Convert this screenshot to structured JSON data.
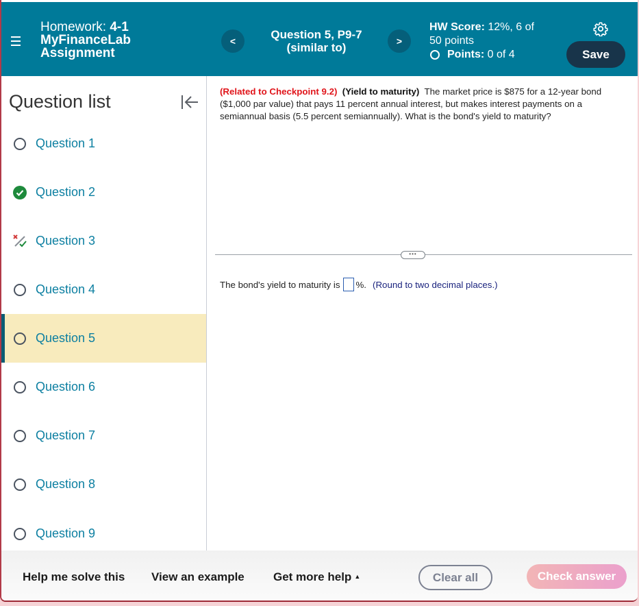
{
  "header": {
    "homework_prefix": "Homework:",
    "homework_number": "4-1",
    "assignment_line1": "MyFinanceLab",
    "assignment_line2": "Assignment",
    "question_title_line1": "Question 5, P9-7",
    "question_title_line2": "(similar to)",
    "prev_label": "<",
    "next_label": ">",
    "hw_score_label": "HW Score:",
    "hw_score_value": "12%, 6 of",
    "hw_score_value2": "50 points",
    "points_label": "Points:",
    "points_value": "0 of 4",
    "save_label": "Save",
    "icons": {
      "menu": "hamburger-menu-icon",
      "settings": "gear-icon"
    }
  },
  "sidebar": {
    "title": "Question list",
    "collapse_icon": "collapse-left-icon",
    "items": [
      {
        "label": "Question 1",
        "status": "unanswered"
      },
      {
        "label": "Question 2",
        "status": "correct"
      },
      {
        "label": "Question 3",
        "status": "partially-correct"
      },
      {
        "label": "Question 4",
        "status": "unanswered"
      },
      {
        "label": "Question 5",
        "status": "unanswered",
        "active": true
      },
      {
        "label": "Question 6",
        "status": "unanswered"
      },
      {
        "label": "Question 7",
        "status": "unanswered"
      },
      {
        "label": "Question 8",
        "status": "unanswered"
      },
      {
        "label": "Question 9",
        "status": "unanswered"
      }
    ]
  },
  "question": {
    "related": "(Related to Checkpoint 9.2)",
    "topic": "(Yield to maturity)",
    "body": "The market price is $875 for a 12-year bond ($1,000 par value) that pays 11 percent annual interest, but makes interest payments on a semiannual basis (5.5 percent semiannually).  What is the bond's yield to maturity?",
    "divider_handle": "•••",
    "answer_prefix": "The bond's yield to maturity is",
    "answer_value": "",
    "answer_suffix": "%.",
    "answer_note": "(Round to two decimal places.)"
  },
  "footer": {
    "help_solve": "Help me solve this",
    "view_example": "View an example",
    "more_help": "Get more help",
    "more_help_caret": "▲",
    "clear_all": "Clear all",
    "check_answer": "Check answer"
  },
  "colors": {
    "header_bg": "#007a99",
    "save_bg": "#18344a",
    "link": "#0c7fa1",
    "related_red": "#e0141a",
    "active_item_bg": "#f8ebbd",
    "correct_green": "#1e8a3c"
  }
}
